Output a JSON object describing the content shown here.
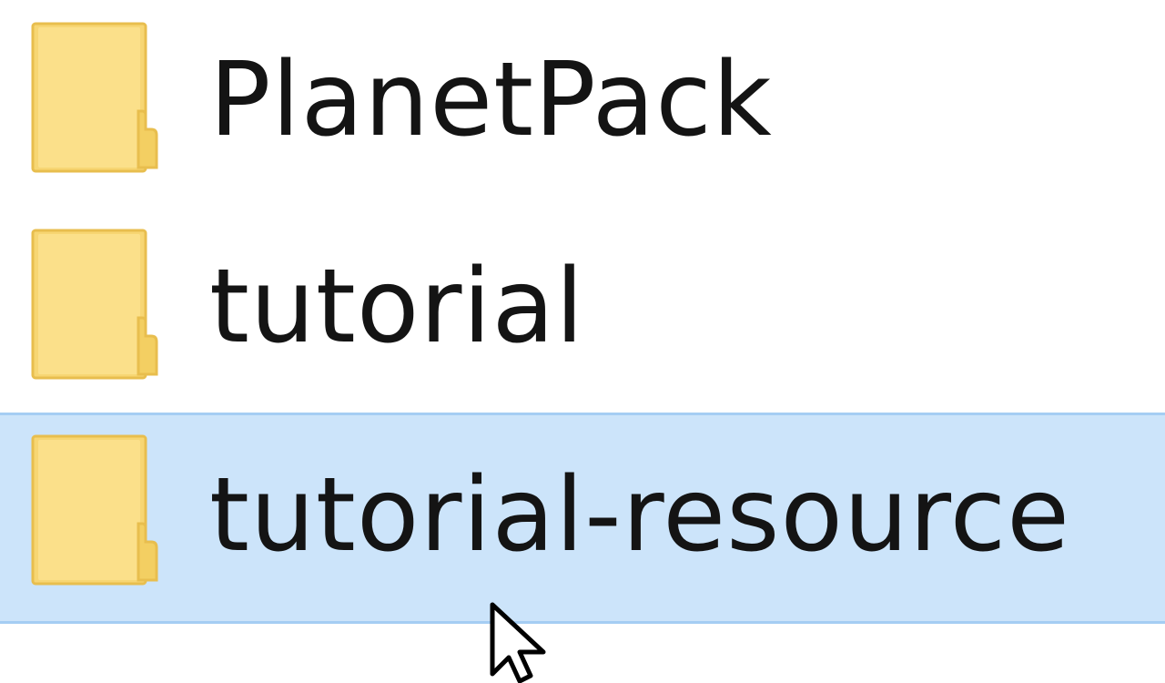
{
  "file_list": {
    "items": [
      {
        "name": "PlanetPack",
        "icon": "folder-icon",
        "selected": false
      },
      {
        "name": "tutorial",
        "icon": "folder-icon",
        "selected": false
      },
      {
        "name": "tutorial-resource",
        "icon": "folder-icon",
        "selected": true
      }
    ]
  },
  "colors": {
    "folder_fill": "#f7d673",
    "folder_edge": "#e8be4e",
    "selection_bg": "#cce4fa",
    "selection_border": "#a5cdf3",
    "text": "#141414"
  },
  "cursor": {
    "icon": "mouse-pointer-icon"
  }
}
